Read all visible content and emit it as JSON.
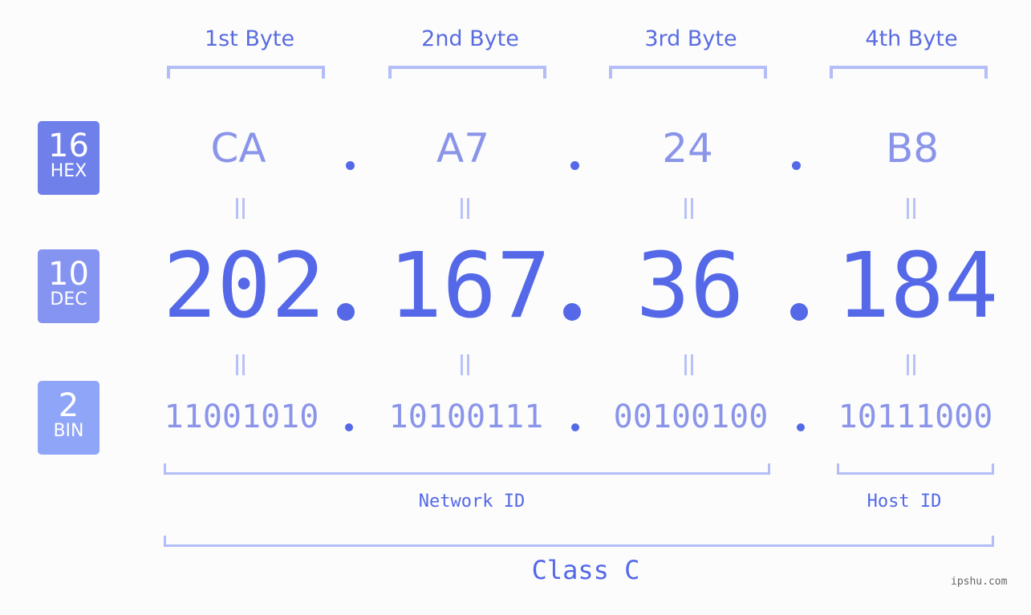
{
  "bytes": {
    "labels": [
      "1st Byte",
      "2nd Byte",
      "3rd Byte",
      "4th Byte"
    ]
  },
  "badges": {
    "hex": {
      "num": "16",
      "label": "HEX",
      "color": "#6f80ea"
    },
    "dec": {
      "num": "10",
      "label": "DEC",
      "color": "#8594f0"
    },
    "bin": {
      "num": "2",
      "label": "BIN",
      "color": "#8fa6f8"
    }
  },
  "hex": {
    "values": [
      "CA",
      "A7",
      "24",
      "B8"
    ]
  },
  "dec": {
    "values": [
      "202",
      "167",
      "36",
      "184"
    ],
    "address": "202.167.36.184"
  },
  "bin": {
    "values": [
      "11001010",
      "10100111",
      "00100100",
      "10111000"
    ]
  },
  "separator": ".",
  "segments": {
    "network_id": "Network ID",
    "host_id": "Host ID",
    "class": "Class C"
  },
  "colors": {
    "primary": "#5468e8",
    "secondary": "#8a95ea",
    "bracket": "#b3bdf8",
    "background": "#fbfcfb"
  },
  "watermark": "ipshu.com"
}
